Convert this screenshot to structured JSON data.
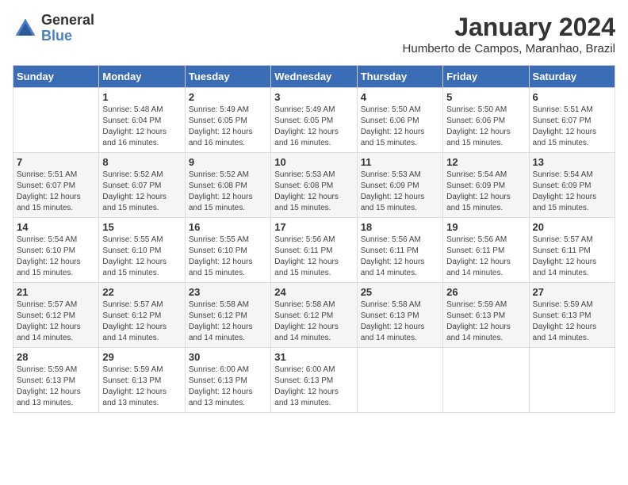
{
  "header": {
    "logo": {
      "general": "General",
      "blue": "Blue"
    },
    "title": "January 2024",
    "subtitle": "Humberto de Campos, Maranhao, Brazil"
  },
  "calendar": {
    "days_of_week": [
      "Sunday",
      "Monday",
      "Tuesday",
      "Wednesday",
      "Thursday",
      "Friday",
      "Saturday"
    ],
    "weeks": [
      [
        {
          "day": "",
          "info": ""
        },
        {
          "day": "1",
          "info": "Sunrise: 5:48 AM\nSunset: 6:04 PM\nDaylight: 12 hours\nand 16 minutes."
        },
        {
          "day": "2",
          "info": "Sunrise: 5:49 AM\nSunset: 6:05 PM\nDaylight: 12 hours\nand 16 minutes."
        },
        {
          "day": "3",
          "info": "Sunrise: 5:49 AM\nSunset: 6:05 PM\nDaylight: 12 hours\nand 16 minutes."
        },
        {
          "day": "4",
          "info": "Sunrise: 5:50 AM\nSunset: 6:06 PM\nDaylight: 12 hours\nand 15 minutes."
        },
        {
          "day": "5",
          "info": "Sunrise: 5:50 AM\nSunset: 6:06 PM\nDaylight: 12 hours\nand 15 minutes."
        },
        {
          "day": "6",
          "info": "Sunrise: 5:51 AM\nSunset: 6:07 PM\nDaylight: 12 hours\nand 15 minutes."
        }
      ],
      [
        {
          "day": "7",
          "info": "Sunrise: 5:51 AM\nSunset: 6:07 PM\nDaylight: 12 hours\nand 15 minutes."
        },
        {
          "day": "8",
          "info": "Sunrise: 5:52 AM\nSunset: 6:07 PM\nDaylight: 12 hours\nand 15 minutes."
        },
        {
          "day": "9",
          "info": "Sunrise: 5:52 AM\nSunset: 6:08 PM\nDaylight: 12 hours\nand 15 minutes."
        },
        {
          "day": "10",
          "info": "Sunrise: 5:53 AM\nSunset: 6:08 PM\nDaylight: 12 hours\nand 15 minutes."
        },
        {
          "day": "11",
          "info": "Sunrise: 5:53 AM\nSunset: 6:09 PM\nDaylight: 12 hours\nand 15 minutes."
        },
        {
          "day": "12",
          "info": "Sunrise: 5:54 AM\nSunset: 6:09 PM\nDaylight: 12 hours\nand 15 minutes."
        },
        {
          "day": "13",
          "info": "Sunrise: 5:54 AM\nSunset: 6:09 PM\nDaylight: 12 hours\nand 15 minutes."
        }
      ],
      [
        {
          "day": "14",
          "info": "Sunrise: 5:54 AM\nSunset: 6:10 PM\nDaylight: 12 hours\nand 15 minutes."
        },
        {
          "day": "15",
          "info": "Sunrise: 5:55 AM\nSunset: 6:10 PM\nDaylight: 12 hours\nand 15 minutes."
        },
        {
          "day": "16",
          "info": "Sunrise: 5:55 AM\nSunset: 6:10 PM\nDaylight: 12 hours\nand 15 minutes."
        },
        {
          "day": "17",
          "info": "Sunrise: 5:56 AM\nSunset: 6:11 PM\nDaylight: 12 hours\nand 15 minutes."
        },
        {
          "day": "18",
          "info": "Sunrise: 5:56 AM\nSunset: 6:11 PM\nDaylight: 12 hours\nand 14 minutes."
        },
        {
          "day": "19",
          "info": "Sunrise: 5:56 AM\nSunset: 6:11 PM\nDaylight: 12 hours\nand 14 minutes."
        },
        {
          "day": "20",
          "info": "Sunrise: 5:57 AM\nSunset: 6:11 PM\nDaylight: 12 hours\nand 14 minutes."
        }
      ],
      [
        {
          "day": "21",
          "info": "Sunrise: 5:57 AM\nSunset: 6:12 PM\nDaylight: 12 hours\nand 14 minutes."
        },
        {
          "day": "22",
          "info": "Sunrise: 5:57 AM\nSunset: 6:12 PM\nDaylight: 12 hours\nand 14 minutes."
        },
        {
          "day": "23",
          "info": "Sunrise: 5:58 AM\nSunset: 6:12 PM\nDaylight: 12 hours\nand 14 minutes."
        },
        {
          "day": "24",
          "info": "Sunrise: 5:58 AM\nSunset: 6:12 PM\nDaylight: 12 hours\nand 14 minutes."
        },
        {
          "day": "25",
          "info": "Sunrise: 5:58 AM\nSunset: 6:13 PM\nDaylight: 12 hours\nand 14 minutes."
        },
        {
          "day": "26",
          "info": "Sunrise: 5:59 AM\nSunset: 6:13 PM\nDaylight: 12 hours\nand 14 minutes."
        },
        {
          "day": "27",
          "info": "Sunrise: 5:59 AM\nSunset: 6:13 PM\nDaylight: 12 hours\nand 14 minutes."
        }
      ],
      [
        {
          "day": "28",
          "info": "Sunrise: 5:59 AM\nSunset: 6:13 PM\nDaylight: 12 hours\nand 13 minutes."
        },
        {
          "day": "29",
          "info": "Sunrise: 5:59 AM\nSunset: 6:13 PM\nDaylight: 12 hours\nand 13 minutes."
        },
        {
          "day": "30",
          "info": "Sunrise: 6:00 AM\nSunset: 6:13 PM\nDaylight: 12 hours\nand 13 minutes."
        },
        {
          "day": "31",
          "info": "Sunrise: 6:00 AM\nSunset: 6:13 PM\nDaylight: 12 hours\nand 13 minutes."
        },
        {
          "day": "",
          "info": ""
        },
        {
          "day": "",
          "info": ""
        },
        {
          "day": "",
          "info": ""
        }
      ]
    ]
  }
}
